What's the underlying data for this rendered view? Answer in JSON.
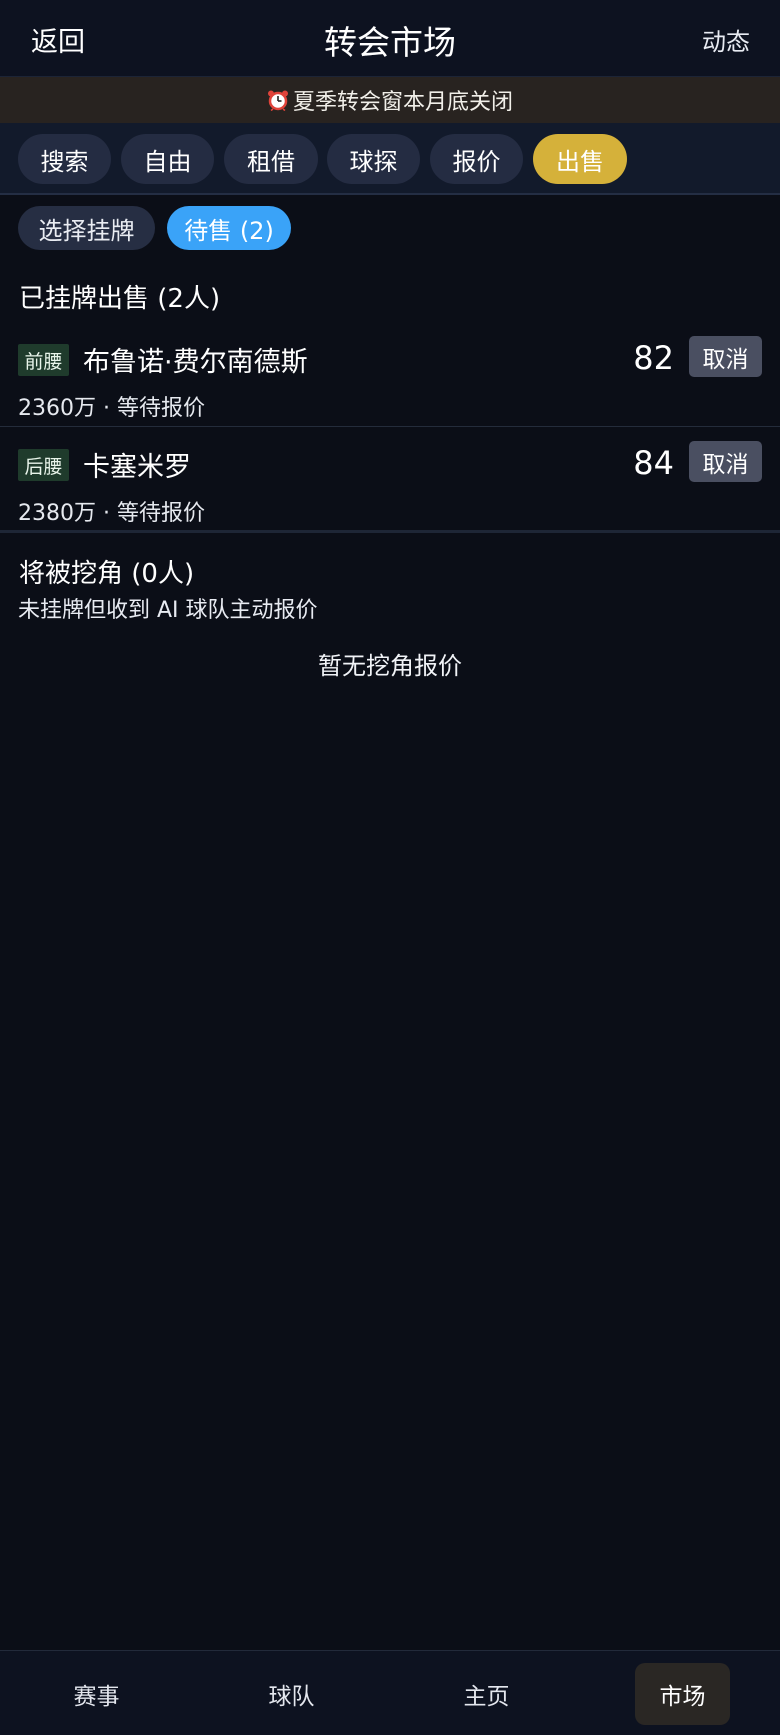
{
  "header": {
    "back_label": "返回",
    "title": "转会市场",
    "news_label": "动态"
  },
  "banner": {
    "icon": "alarm-clock-icon",
    "text": "夏季转会窗本月底关闭"
  },
  "tabs": [
    {
      "label": "搜索",
      "active": false
    },
    {
      "label": "自由",
      "active": false
    },
    {
      "label": "租借",
      "active": false
    },
    {
      "label": "球探",
      "active": false
    },
    {
      "label": "报价",
      "active": false
    },
    {
      "label": "出售",
      "active": true
    }
  ],
  "subtabs": [
    {
      "label": "选择挂牌",
      "active": false
    },
    {
      "label": "待售 (2)",
      "active": true
    }
  ],
  "listed": {
    "title": "已挂牌出售 (2人)",
    "players": [
      {
        "position": "前腰",
        "name": "布鲁诺·费尔南德斯",
        "rating": "82",
        "action": "取消",
        "meta": "2360万 · 等待报价"
      },
      {
        "position": "后腰",
        "name": "卡塞米罗",
        "rating": "84",
        "action": "取消",
        "meta": "2380万 · 等待报价"
      }
    ]
  },
  "poached": {
    "title": "将被挖角 (0人)",
    "subtitle": "未挂牌但收到 AI 球队主动报价",
    "empty_text": "暂无挖角报价"
  },
  "bottom_nav": [
    {
      "label": "赛事",
      "active": false
    },
    {
      "label": "球队",
      "active": false
    },
    {
      "label": "主页",
      "active": false
    },
    {
      "label": "市场",
      "active": true
    }
  ],
  "colors": {
    "background": "#0b0e17",
    "active_tab": "#d5b13a",
    "active_subtab": "#3aa3f8",
    "position_badge": "#1f3b2c"
  }
}
